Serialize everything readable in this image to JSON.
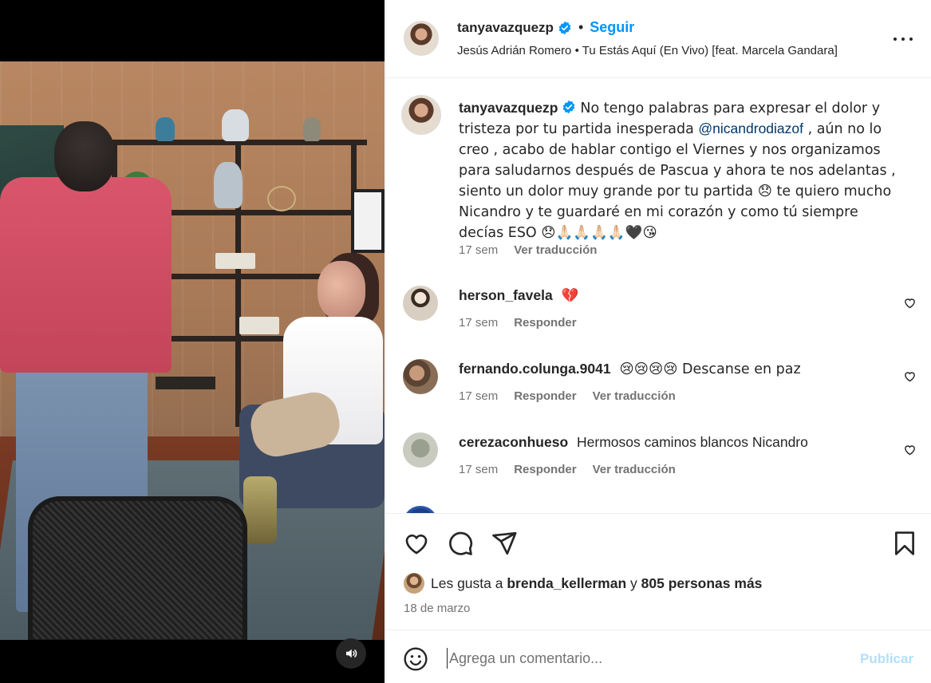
{
  "post": {
    "username": "tanyavazquezp",
    "follow_label": "Seguir",
    "separator": "•",
    "audio": "Jesús Adrián Romero • Tu Estás Aquí (En Vivo) [feat. Marcela Gandara]"
  },
  "caption": {
    "username": "tanyavazquezp",
    "text_1": "No tengo palabras para expresar el dolor y tristeza por tu partida inesperada ",
    "mention": "@nicandrodiazof",
    "text_2": " , aún no lo creo , acabo de hablar contigo el Viernes y nos organizamos para saludarnos después de Pascua y ahora te nos adelantas , siento un dolor muy grande por tu partida 😞 te quiero mucho Nicandro y te guardaré en mi corazón y como tú siempre decías ESO 😞🙏🏻🙏🏻🙏🏻🙏🏻🖤😘",
    "time": "17 sem",
    "translate": "Ver traducción"
  },
  "comments": [
    {
      "username": "herson_favela",
      "text": "💔",
      "time": "17 sem",
      "reply": "Responder",
      "translate": ""
    },
    {
      "username": "fernando.colunga.9041",
      "text": "😢😢😢😢 Descanse en paz",
      "time": "17 sem",
      "reply": "Responder",
      "translate": "Ver traducción"
    },
    {
      "username": "cerezaconhueso",
      "text": "Hermosos caminos blancos Nicandro",
      "time": "17 sem",
      "reply": "Responder",
      "translate": "Ver traducción"
    }
  ],
  "likes": {
    "prefix": "Les gusta a",
    "user": "brenda_kellerman",
    "connector": "y",
    "others": "805 personas más"
  },
  "date": "18 de marzo",
  "composer": {
    "placeholder": "Agrega un comentario...",
    "publish": "Publicar"
  },
  "colors": {
    "accent": "#0095f6",
    "verified": "#0095f6",
    "publish_disabled": "#b2dffc",
    "muted_text": "#737373"
  },
  "icons": [
    "mute-icon",
    "verified-icon",
    "more-icon",
    "heart-icon",
    "comment-icon",
    "share-icon",
    "bookmark-icon",
    "emoji-icon"
  ]
}
